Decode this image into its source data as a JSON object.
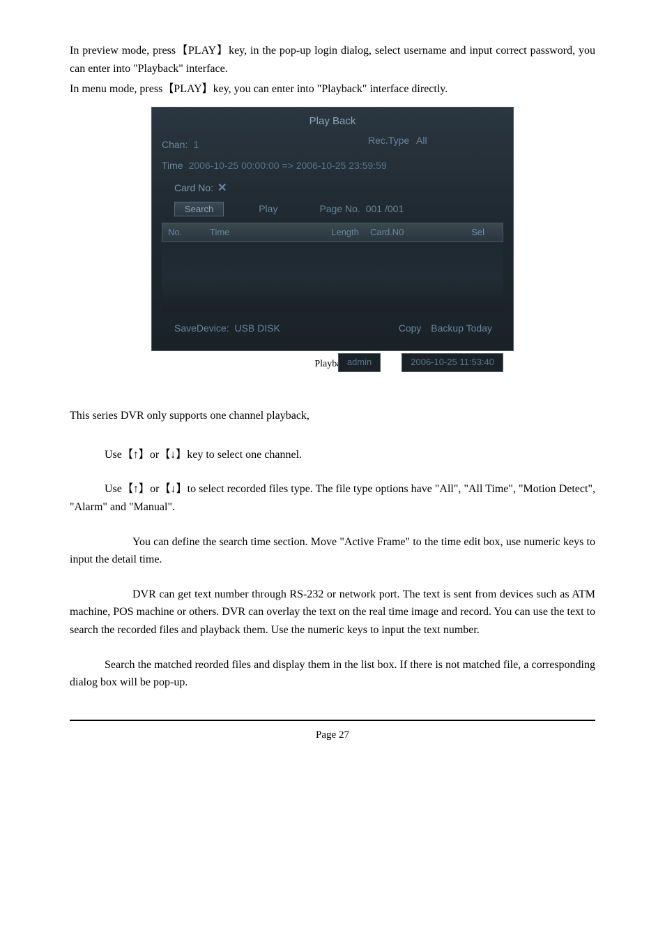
{
  "intro1": "In preview mode, press【PLAY】key, in the pop-up login dialog, select username and input correct password, you can enter into \"Playback\" interface.",
  "intro2": "In menu mode, press【PLAY】key, you can enter into \"Playback\" interface directly.",
  "panel": {
    "title": "Play Back",
    "chan_label": "Chan:",
    "chan_value": "1",
    "rectype_label": "Rec.Type",
    "rectype_value": "All",
    "time_label": "Time",
    "time_value": "2006-10-25  00:00:00 => 2006-10-25  23:59:59",
    "cardno_label": "Card No:",
    "cardno_x": "✕",
    "search_btn": "Search",
    "play_label": "Play",
    "pageno_label": "Page No.",
    "pageno_value": "001 /001",
    "th_no": "No.",
    "th_time": "Time",
    "th_length": "Length",
    "th_cardno": "Card.N0",
    "th_sel": "Sel",
    "savedev_label": "SaveDevice:",
    "savedev_value": "USB DISK",
    "copy_label": "Copy",
    "backup_label": "Backup Today",
    "status_user": "admin",
    "status_time": "2006-10-25 11:53:40"
  },
  "caption": "Playback",
  "note": "This series DVR only supports one channel playback,",
  "chan_text": "Use【↑】or【↓】key to select one channel.",
  "rectype_text": "Use【↑】or【↓】to select recorded files type. The file type options have \"All\", \"All Time\", \"Motion Detect\", \"Alarm\" and \"Manual\".",
  "timesection_text": "You can define the search time section. Move \"Active Frame\" to the time edit box, use numeric keys to input the detail time.",
  "cardnumber_text": "DVR can get text number through RS-232 or network port. The text is sent from devices such as ATM machine, POS machine or others. DVR can overlay the text on the real time image and record. You can use the text to search the recorded files and playback them. Use the numeric keys to input the text number.",
  "search_text": "Search the matched reorded files and display them in the list box. If there is not matched file, a corresponding dialog box will be pop-up.",
  "footer": "Page 27"
}
